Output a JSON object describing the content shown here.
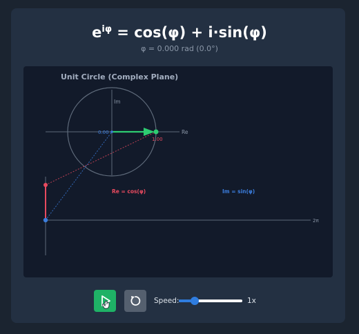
{
  "header": {
    "title_base": "e",
    "title_exp": "iφ",
    "title_rest": " = cos(φ) + i·sin(φ)",
    "subtitle": "φ = 0.000 rad (0.0°)"
  },
  "plot": {
    "circle_title": "Unit Circle (Complex Plane)",
    "axis_im": "Im",
    "axis_re": "Re",
    "origin_value": "0.00",
    "point_value": "1.00",
    "legend_re": "Re = cos(φ)",
    "legend_im": "Im = sin(φ)",
    "time_axis_end": "2π",
    "phi": 0,
    "colors": {
      "re": "#e84a5f",
      "im": "#3b7ddd",
      "vector": "#2ecc71",
      "circle": "#5f6b7b"
    }
  },
  "controls": {
    "play_icon": "play-icon",
    "reset_icon": "reset-icon",
    "speed_label": "Speed:",
    "speed_value": "1x",
    "speed_fraction": 0.25
  }
}
